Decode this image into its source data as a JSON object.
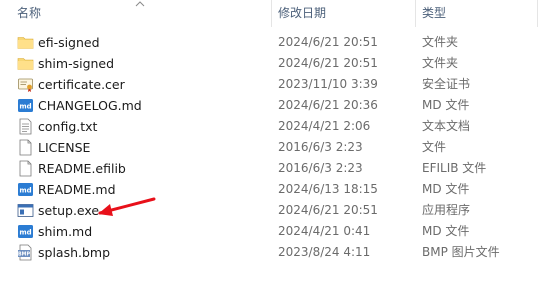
{
  "header": {
    "name_label": "名称",
    "date_label": "修改日期",
    "type_label": "类型"
  },
  "files": [
    {
      "name": "efi-signed",
      "date": "2024/6/21 20:51",
      "type": "文件夹",
      "icon": "folder-icon"
    },
    {
      "name": "shim-signed",
      "date": "2024/6/21 20:51",
      "type": "文件夹",
      "icon": "folder-icon"
    },
    {
      "name": "certificate.cer",
      "date": "2023/11/10 3:39",
      "type": "安全证书",
      "icon": "certificate-icon"
    },
    {
      "name": "CHANGELOG.md",
      "date": "2024/6/21 20:36",
      "type": "MD 文件",
      "icon": "markdown-icon"
    },
    {
      "name": "config.txt",
      "date": "2024/4/21 2:06",
      "type": "文本文档",
      "icon": "text-file-icon"
    },
    {
      "name": "LICENSE",
      "date": "2016/6/3 2:23",
      "type": "文件",
      "icon": "blank-file-icon"
    },
    {
      "name": "README.efilib",
      "date": "2016/6/3 2:23",
      "type": "EFILIB 文件",
      "icon": "blank-file-icon"
    },
    {
      "name": "README.md",
      "date": "2024/6/13 18:15",
      "type": "MD 文件",
      "icon": "markdown-icon"
    },
    {
      "name": "setup.exe",
      "date": "2024/6/21 20:51",
      "type": "应用程序",
      "icon": "application-icon"
    },
    {
      "name": "shim.md",
      "date": "2024/4/21 0:41",
      "type": "MD 文件",
      "icon": "markdown-icon"
    },
    {
      "name": "splash.bmp",
      "date": "2023/8/24 4:11",
      "type": "BMP 图片文件",
      "icon": "bitmap-image-icon"
    }
  ],
  "annotation": {
    "arrow_color": "#e8101a",
    "target": "setup.exe"
  },
  "colors": {
    "folder": "#f8d775",
    "markdown_badge": "#2b7cd3",
    "header_text": "#4c607a"
  }
}
